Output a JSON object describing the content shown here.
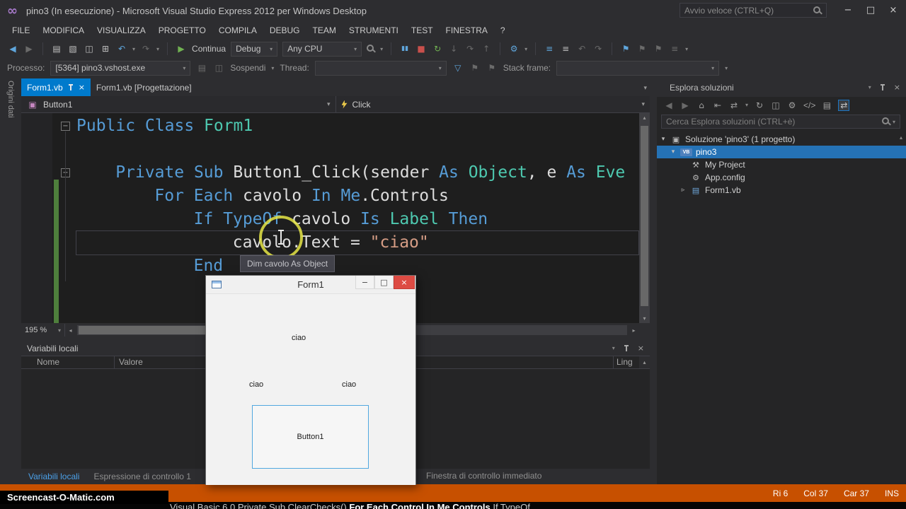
{
  "colors": {
    "accent_blue": "#007ACC",
    "status_orange": "#C75000",
    "editor_bg": "#1E1E1E",
    "panel_bg": "#252526",
    "chrome_bg": "#2D2D30",
    "keyword": "#569CD6",
    "type_name": "#4EC9B0",
    "string_literal": "#D69D85",
    "plain_code": "#DCDCDC"
  },
  "title_bar": {
    "title": "pino3 (In esecuzione) - Microsoft Visual Studio Express 2012 per Windows Desktop",
    "quick_launch_placeholder": "Avvio veloce (CTRL+Q)"
  },
  "menu_bar": {
    "items": [
      "FILE",
      "MODIFICA",
      "VISUALIZZA",
      "PROGETTO",
      "COMPILA",
      "DEBUG",
      "TEAM",
      "STRUMENTI",
      "TEST",
      "FINESTRA",
      "?"
    ]
  },
  "toolbar": {
    "continue_label": "Continua",
    "debug_combo_value": "Debug",
    "platform_combo_value": "Any CPU"
  },
  "process_bar": {
    "process_label": "Processo:",
    "process_combo_value": "[5364] pino3.vshost.exe",
    "suspend_label": "Sospendi",
    "thread_label": "Thread:",
    "thread_combo_value": "",
    "stack_label": "Stack frame:",
    "stack_combo_value": ""
  },
  "editor": {
    "tabs": [
      {
        "label": "Form1.vb",
        "active": true
      },
      {
        "label": "Form1.vb [Progettazione]",
        "active": false
      }
    ],
    "nav_object": "Button1",
    "nav_event": "Click",
    "zoom_value": "195 %",
    "tooltip_text": "Dim cavolo As Object",
    "code_lines": [
      {
        "indent": 0,
        "collapse": true,
        "tokens": [
          {
            "t": "Public Class ",
            "c": "kw"
          },
          {
            "t": "Form1",
            "c": "type"
          }
        ]
      },
      {
        "indent": 0,
        "tokens": []
      },
      {
        "indent": 4,
        "collapse": true,
        "tokens": [
          {
            "t": "Private Sub ",
            "c": "kw"
          },
          {
            "t": "Button1_Click(sender ",
            "c": "plain"
          },
          {
            "t": "As ",
            "c": "kw"
          },
          {
            "t": "Object",
            "c": "type"
          },
          {
            "t": ", e ",
            "c": "plain"
          },
          {
            "t": "As ",
            "c": "kw"
          },
          {
            "t": "Eve",
            "c": "type"
          }
        ]
      },
      {
        "indent": 8,
        "tokens": [
          {
            "t": "For Each ",
            "c": "kw"
          },
          {
            "t": "cavolo ",
            "c": "plain"
          },
          {
            "t": "In ",
            "c": "kw"
          },
          {
            "t": "Me",
            "c": "kw"
          },
          {
            "t": ".Controls",
            "c": "plain"
          }
        ]
      },
      {
        "indent": 12,
        "tokens": [
          {
            "t": "If TypeOf ",
            "c": "kw"
          },
          {
            "t": "cavolo ",
            "c": "plain"
          },
          {
            "t": "Is ",
            "c": "kw"
          },
          {
            "t": "Label ",
            "c": "type"
          },
          {
            "t": "Then",
            "c": "kw"
          }
        ]
      },
      {
        "indent": 16,
        "current": true,
        "tokens": [
          {
            "t": "cavolo.Text = ",
            "c": "plain"
          },
          {
            "t": "\"ciao\"",
            "c": "str"
          }
        ]
      },
      {
        "indent": 12,
        "tokens": [
          {
            "t": "End",
            "c": "kw"
          }
        ]
      }
    ]
  },
  "solution_explorer": {
    "title": "Esplora soluzioni",
    "search_placeholder": "Cerca Esplora soluzioni (CTRL+è)",
    "tree": [
      {
        "label": "Soluzione 'pino3' (1 progetto)",
        "depth": 0,
        "expander": "open",
        "icon": "solution"
      },
      {
        "label": "pino3",
        "depth": 1,
        "expander": "open",
        "icon": "vb-project",
        "selected": true
      },
      {
        "label": "My Project",
        "depth": 2,
        "icon": "my-project"
      },
      {
        "label": "App.config",
        "depth": 2,
        "icon": "config"
      },
      {
        "label": "Form1.vb",
        "depth": 2,
        "expander": "closed",
        "icon": "form"
      }
    ]
  },
  "locals_panel": {
    "title": "Variabili locali",
    "columns": [
      "Nome",
      "Valore",
      "Ling"
    ]
  },
  "bottom_tabs": [
    {
      "label": "Variabili locali",
      "active": true
    },
    {
      "label": "Espressione di controllo 1",
      "active": false
    },
    {
      "label": "Finestra di controllo immediato",
      "active": false
    }
  ],
  "status_bar": {
    "row": "Ri 6",
    "column": "Col 37",
    "character": "Car 37",
    "mode": "INS"
  },
  "form_window": {
    "title": "Form1",
    "labels": [
      "ciao",
      "ciao",
      "ciao"
    ],
    "button_label": "Button1"
  },
  "left_tab": "Origini dati",
  "watermark": "Screencast-O-Matic.com",
  "bottom_strip": {
    "segments": [
      {
        "text": "Visual Basic 6.0  Private Sub ClearChecks()  ",
        "bold": false
      },
      {
        "text": "For Each Control In Me.Controls",
        "bold": true
      },
      {
        "text": "  If TypeOf ...",
        "bold": false
      }
    ]
  },
  "icons": {
    "back": "◀",
    "forward": "▶",
    "new_file": "▤",
    "add_item": "▧",
    "save": "◫",
    "save_all": "⊞",
    "undo": "↶",
    "redo": "↷",
    "caret": "▾",
    "play": "▶",
    "pause": "▮▮",
    "stop": "■",
    "restart": "↻",
    "step_into": "↓",
    "step_over": "↷",
    "step_out": "↑",
    "gear": "⚙",
    "list": "≡",
    "flag": "⚑",
    "home": "⌂",
    "sync": "⇄",
    "refresh": "↻",
    "collapse_all": "⇤",
    "show_all": "◫",
    "code_view": "</>",
    "funnel": "▽",
    "minimize": "−",
    "maximize": "□",
    "close": "×",
    "infinity": "∞",
    "cube": "▣",
    "up": "▴",
    "down": "▾",
    "left": "◂",
    "right": "▸",
    "fold_minus": "−"
  }
}
